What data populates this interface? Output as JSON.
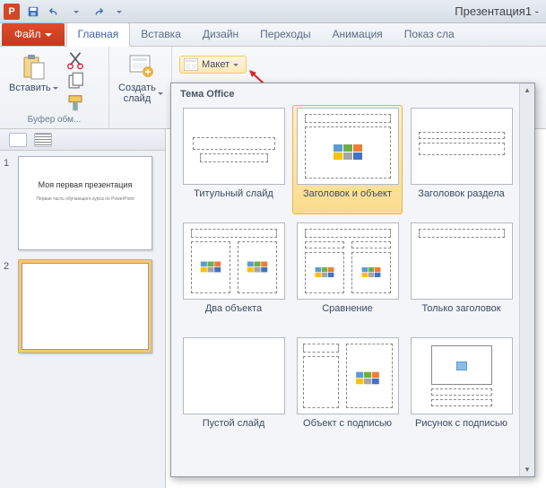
{
  "app": {
    "title": "Презентация1 -"
  },
  "tabs": {
    "file": "Файл",
    "home": "Главная",
    "insert": "Вставка",
    "design": "Дизайн",
    "transitions": "Переходы",
    "animation": "Анимация",
    "slideshow": "Показ сла"
  },
  "ribbon": {
    "clipboard_group": "Буфер обм...",
    "paste": "Вставить",
    "slides_group": "",
    "new_slide": "Создать\nслайд",
    "layout_btn": "Макет"
  },
  "panel": {
    "slide1": {
      "num": "1",
      "title": "Моя первая презентация",
      "sub": "Первая часть обучающего курса по PowerPoint"
    },
    "slide2": {
      "num": "2"
    }
  },
  "gallery": {
    "theme_label": "Тема Office",
    "items": [
      {
        "label": "Титульный слайд"
      },
      {
        "label": "Заголовок и объект"
      },
      {
        "label": "Заголовок раздела"
      },
      {
        "label": "Два объекта"
      },
      {
        "label": "Сравнение"
      },
      {
        "label": "Только заголовок"
      },
      {
        "label": "Пустой слайд"
      },
      {
        "label": "Объект с подписью"
      },
      {
        "label": "Рисунок с подписью"
      }
    ]
  }
}
